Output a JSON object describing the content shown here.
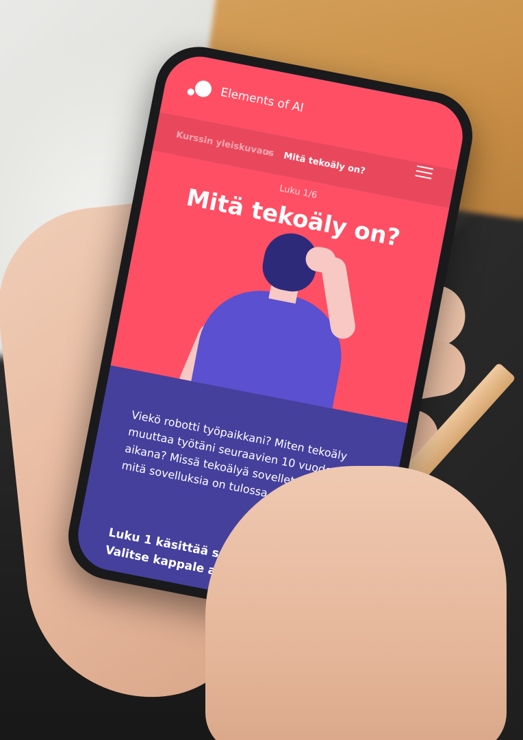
{
  "app": {
    "brand": "Elements of AI"
  },
  "breadcrumb": {
    "parent": "Kurssin yleiskuvaus",
    "separator": ">",
    "current": "Mitä tekoäly on?"
  },
  "hero": {
    "chapter_label": "Luku 1/6",
    "title": "Mitä tekoäly on?"
  },
  "content": {
    "intro": "Viekö robotti työpaikkani? Miten tekoäly muuttaa työtäni seuraavien 10 vuoden aikana? Missä tekoälyä sovelletaan jo nyt, ja mitä sovelluksia on tulossa seuraavaksi?",
    "topics_heading": "Luku 1 käsittää seuraavat kappaleet. Valitse kappale alta:"
  },
  "icons": {
    "logo": "elements-of-ai-logo-icon",
    "menu": "hamburger-menu-icon"
  },
  "colors": {
    "primary": "#ff4f64",
    "breadcrumb_bg": "#e9485c",
    "content_bg": "#45409c"
  }
}
